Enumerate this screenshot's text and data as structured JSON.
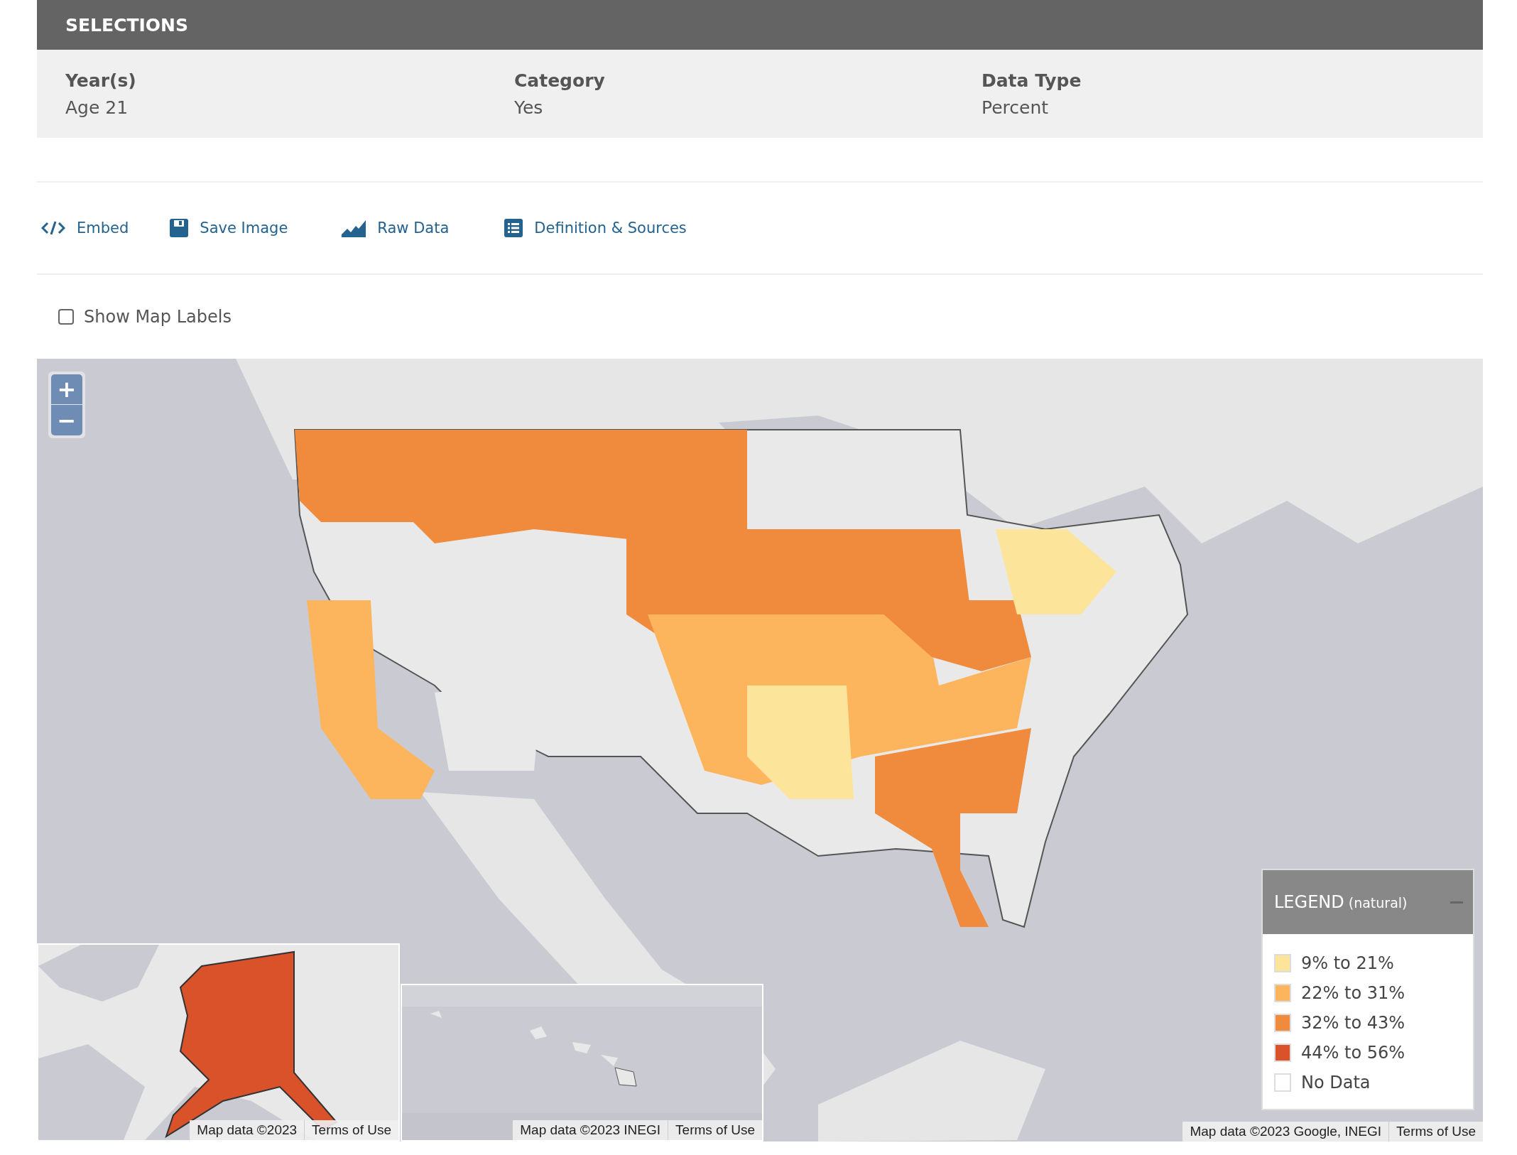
{
  "selections": {
    "title": "SELECTIONS",
    "fields": [
      {
        "label": "Year(s)",
        "value": "Age 21"
      },
      {
        "label": "Category",
        "value": "Yes"
      },
      {
        "label": "Data Type",
        "value": "Percent"
      }
    ]
  },
  "toolbar": [
    {
      "kind": "embed",
      "label": "Embed"
    },
    {
      "kind": "save",
      "label": "Save Image"
    },
    {
      "kind": "raw",
      "label": "Raw Data"
    },
    {
      "kind": "definition",
      "label": "Definition & Sources"
    }
  ],
  "map_labels": {
    "label": "Show Map Labels",
    "checked": false
  },
  "map": {
    "kind": "picture",
    "zoom_in": "+",
    "zoom_out": "−",
    "legend": {
      "title": "LEGEND",
      "subtitle": "(natural)",
      "items": [
        {
          "label": "9% to 21%",
          "color": "#fde49b"
        },
        {
          "label": "22% to 31%",
          "color": "#fcb55c"
        },
        {
          "label": "32% to 43%",
          "color": "#f08a3c"
        },
        {
          "label": "44% to 56%",
          "color": "#d9522a"
        },
        {
          "label": "No Data",
          "color": "#ffffff"
        }
      ]
    },
    "attribution": {
      "data": "Map data ©2023 Google, INEGI",
      "terms": "Terms of Use"
    },
    "insets": [
      {
        "kind": "picture",
        "data": "Map data ©2023",
        "terms": "Terms of Use"
      },
      {
        "kind": "picture",
        "data": "Map data ©2023 INEGI",
        "terms": "Terms of Use"
      }
    ]
  }
}
